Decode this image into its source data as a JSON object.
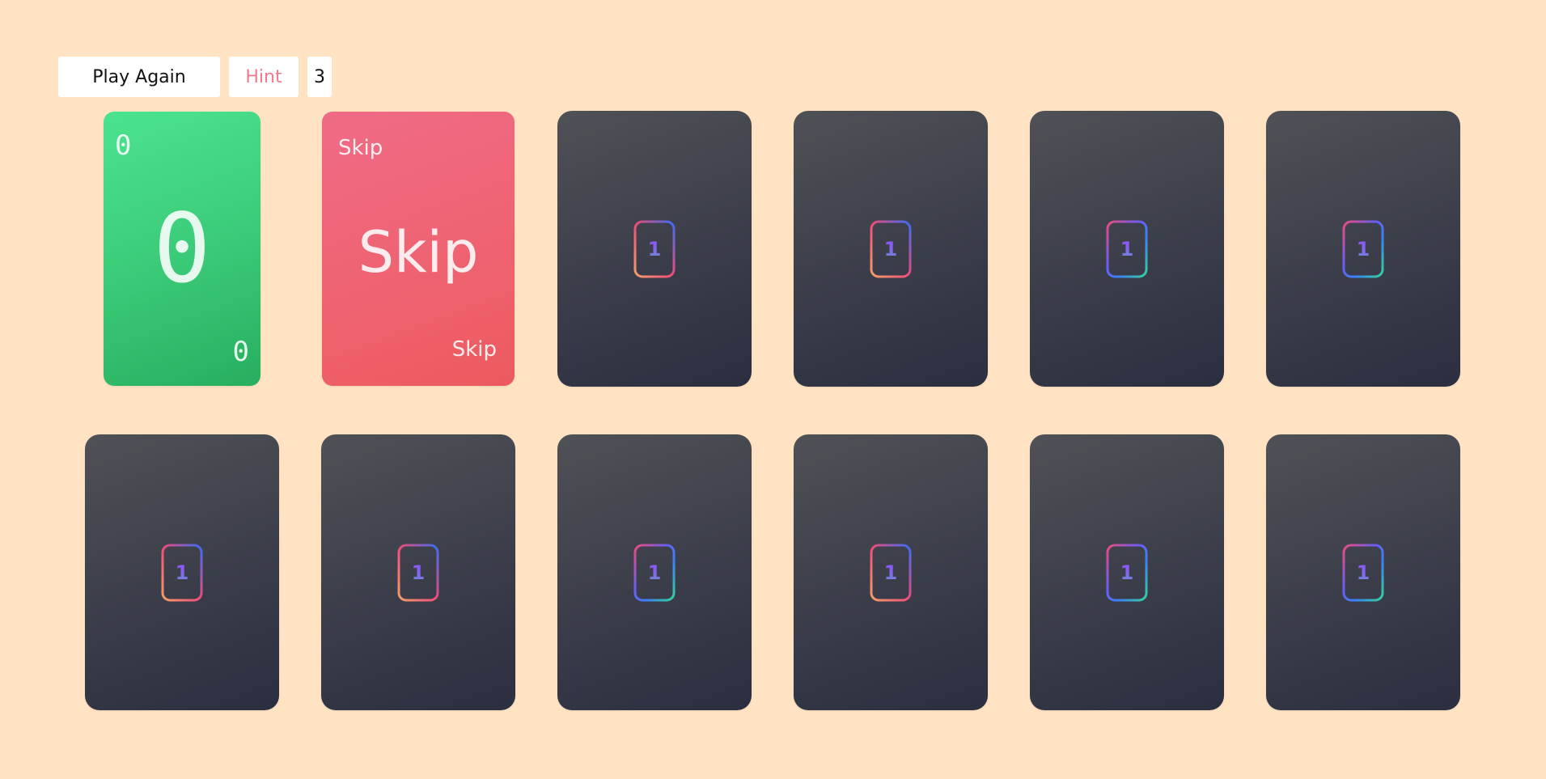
{
  "controls": {
    "play_again_label": "Play Again",
    "hint_label": "Hint",
    "counter": "3"
  },
  "colors": {
    "background": "#ffe3c2",
    "card_back": "#3e414b",
    "green_card": "#3ccc79",
    "red_card": "#ef6474",
    "hint_text": "#ef7b8c"
  },
  "cards": [
    {
      "state": "face-up",
      "color": "green",
      "value": "0"
    },
    {
      "state": "face-up",
      "color": "red",
      "value": "Skip"
    },
    {
      "state": "face-down",
      "badge": "1"
    },
    {
      "state": "face-down",
      "badge": "1"
    },
    {
      "state": "face-down",
      "badge": "1"
    },
    {
      "state": "face-down",
      "badge": "1"
    },
    {
      "state": "face-down",
      "badge": "1"
    },
    {
      "state": "face-down",
      "badge": "1"
    },
    {
      "state": "face-down",
      "badge": "1"
    },
    {
      "state": "face-down",
      "badge": "1"
    },
    {
      "state": "face-down",
      "badge": "1"
    },
    {
      "state": "face-down",
      "badge": "1"
    }
  ]
}
